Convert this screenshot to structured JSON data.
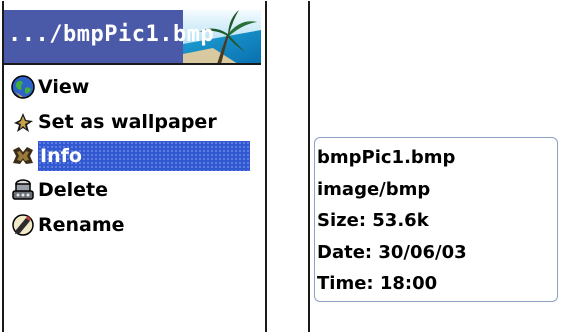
{
  "left_screen": {
    "title": ".../bmpPic1.bmp",
    "menu": [
      {
        "label": "View",
        "icon": "globe-icon",
        "selected": false
      },
      {
        "label": "Set as wallpaper",
        "icon": "pin-icon",
        "selected": false
      },
      {
        "label": "Info",
        "icon": "info-icon",
        "selected": true
      },
      {
        "label": "Delete",
        "icon": "delete-icon",
        "selected": false
      },
      {
        "label": "Rename",
        "icon": "rename-icon",
        "selected": false
      }
    ]
  },
  "right_screen": {
    "info_lines": [
      "bmpPic1.bmp",
      "image/bmp",
      "Size: 53.6k",
      "Date: 30/06/03",
      "Time: 18:00"
    ]
  },
  "colors": {
    "title_bar": "#4a5aa8",
    "selection": "#3157d1",
    "info_border": "#8fa0c2"
  }
}
